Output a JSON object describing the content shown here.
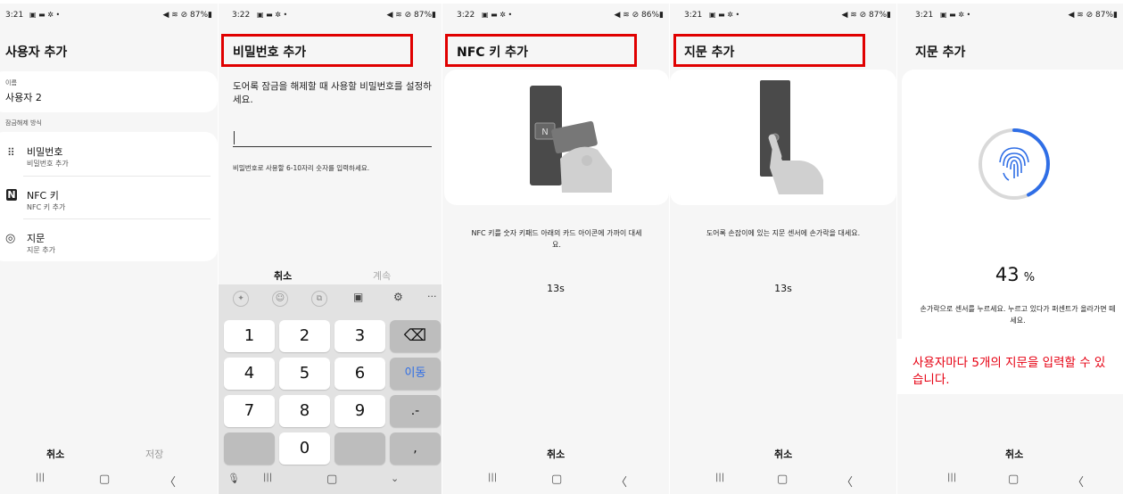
{
  "panels": [
    {
      "status": {
        "time": "3:21",
        "icons": "▣ ▬ ✲ •",
        "right": "◀ ≋ ⊘ 87%▮"
      },
      "title": "사용자 추가",
      "name_label": "이름",
      "name_value": "사용자 2",
      "section_label": "잠금해제 방식",
      "methods": [
        {
          "icon": "keypad-icon",
          "glyph": "⠿",
          "label": "비밀번호",
          "sub": "비밀번호 추가"
        },
        {
          "icon": "nfc-icon",
          "glyph": "N",
          "label": "NFC 키",
          "sub": "NFC 키 추가"
        },
        {
          "icon": "fingerprint-icon",
          "glyph": "◎",
          "label": "지문",
          "sub": "지문 추가"
        }
      ],
      "cancel": "취소",
      "save": "저장"
    },
    {
      "status": {
        "time": "3:22",
        "icons": "▣ ▬ ✲ •",
        "right": "◀ ≋ ⊘ 87%▮"
      },
      "title": "비밀번호 추가",
      "desc": "도어록 잠금을 해제할 때 사용할 비밀번호를 설정하세요.",
      "hint": "비밀번호로 사용할 6-10자리 숫자를 입력하세요.",
      "cancel": "취소",
      "next": "계속",
      "toolbar_icons": [
        "sparkle-icon",
        "emoji-icon",
        "clipboard-copy-icon",
        "clipboard-icon",
        "settings-icon",
        "more-icon"
      ],
      "keys": [
        "1",
        "2",
        "3",
        "⌫",
        "4",
        "5",
        "6",
        "이동",
        "7",
        "8",
        "9",
        ".-",
        "",
        "0",
        "",
        ","
      ]
    },
    {
      "status": {
        "time": "3:22",
        "icons": "▣ ▬ ✲ •",
        "right": "◀ ≋ ⊘ 86%▮"
      },
      "title": "NFC 키 추가",
      "instruction": "NFC 키를 숫자 키패드 아래의 카드 아이콘에 가까이 대세요.",
      "timer": "13s",
      "cancel": "취소"
    },
    {
      "status": {
        "time": "3:21",
        "icons": "▣ ▬ ✲ •",
        "right": "◀ ≋ ⊘ 87%▮"
      },
      "title": "지문 추가",
      "instruction": "도어록 손잡이에 있는 지문 센서에 손가락을 대세요.",
      "timer": "13s",
      "cancel": "취소"
    },
    {
      "status": {
        "time": "3:21",
        "icons": "▣ ▬ ✲ •",
        "right": "◀ ≋ ⊘ 87%▮"
      },
      "title": "지문 추가",
      "percent": "43",
      "percent_unit": "%",
      "progress": 0.43,
      "instruction": "손가락으로 센서를 누르세요. 누르고 있다가 퍼센트가 올라가면 떼세요.",
      "note": "사용자마다 5개의 지문을 입력할 수 있습니다.",
      "cancel": "취소"
    }
  ],
  "nav": {
    "recent": "|||",
    "home": "▢",
    "back": "〈"
  },
  "colors": {
    "accent_red": "#e00000",
    "progress_blue": "#2f6ee6",
    "note_red": "#e60012"
  }
}
